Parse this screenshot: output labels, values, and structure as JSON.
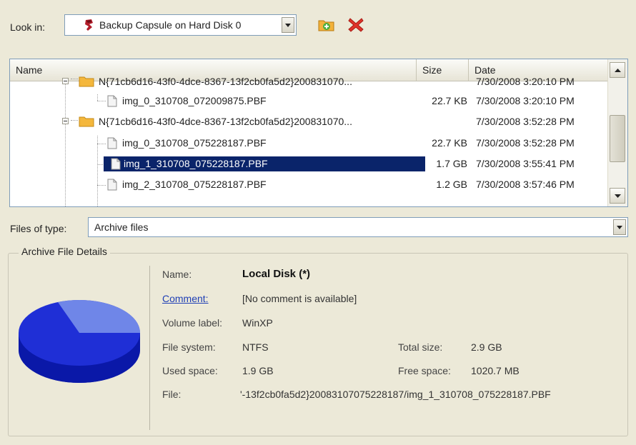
{
  "toolbar": {
    "look_in_label": "Look in:",
    "location": "Backup Capsule on Hard Disk 0",
    "icons": [
      "new-folder-icon",
      "delete-icon"
    ]
  },
  "list": {
    "columns": {
      "name": "Name",
      "size": "Size",
      "date": "Date"
    },
    "rows": [
      {
        "kind": "folder",
        "name": "N{71cb6d16-43f0-4dce-8367-13f2cb0fa5d2}200831070...",
        "size": "",
        "date": "7/30/2008 3:20:10 PM"
      },
      {
        "kind": "file",
        "name": "img_0_310708_072009875.PBF",
        "size": "22.7 KB",
        "date": "7/30/2008 3:20:10 PM"
      },
      {
        "kind": "folder",
        "name": "N{71cb6d16-43f0-4dce-8367-13f2cb0fa5d2}200831070...",
        "size": "",
        "date": "7/30/2008 3:52:28 PM"
      },
      {
        "kind": "file",
        "name": "img_0_310708_075228187.PBF",
        "size": "22.7 KB",
        "date": "7/30/2008 3:52:28 PM"
      },
      {
        "kind": "file",
        "name": "img_1_310708_075228187.PBF",
        "size": "1.7 GB",
        "date": "7/30/2008 3:55:41 PM",
        "selected": true
      },
      {
        "kind": "file",
        "name": "img_2_310708_075228187.PBF",
        "size": "1.2 GB",
        "date": "7/30/2008 3:57:46 PM"
      }
    ]
  },
  "filetype": {
    "label": "Files of type:",
    "value": "Archive files"
  },
  "details": {
    "title": "Archive File Details",
    "name_label": "Name:",
    "name_value": "Local Disk (*)",
    "comment_label": "Comment:",
    "comment_value": "[No comment is available]",
    "volume_label": "Volume label:",
    "volume_value": "WinXP",
    "fs_label": "File system:",
    "fs_value": "NTFS",
    "total_label": "Total size:",
    "total_value": "2.9 GB",
    "used_label": "Used space:",
    "used_value": "1.9 GB",
    "free_label": "Free space:",
    "free_value": "1020.7 MB",
    "file_label": "File:",
    "file_value": "'-13f2cb0fa5d2}20083107075228187/img_1_310708_075228187.PBF"
  },
  "colors": {
    "selection": "#0a246a",
    "pie_used": "#1f2fd6",
    "pie_free": "#6f86e8",
    "link": "#1f3fb5"
  }
}
